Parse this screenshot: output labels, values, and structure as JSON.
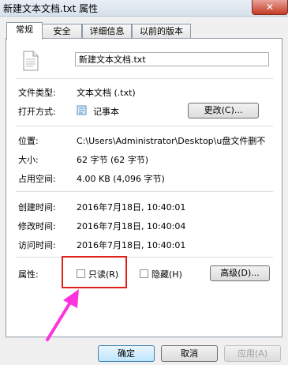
{
  "window": {
    "title": "新建文本文档.txt 属性",
    "close_glyph": "✕"
  },
  "tabs": [
    {
      "label": "常规",
      "active": true
    },
    {
      "label": "安全",
      "active": false
    },
    {
      "label": "详细信息",
      "active": false
    },
    {
      "label": "以前的版本",
      "active": false
    }
  ],
  "file": {
    "name": "新建文本文档.txt",
    "icon": "text-file-icon"
  },
  "info": {
    "type_label": "文件类型:",
    "type_value": "文本文档 (.txt)",
    "opens_label": "打开方式:",
    "opens_value": "记事本",
    "opens_icon": "notepad-icon",
    "change_button": "更改(C)...",
    "location_label": "位置:",
    "location_value": "C:\\Users\\Administrator\\Desktop\\u盘文件删不",
    "size_label": "大小:",
    "size_value": "62 字节 (62 字节)",
    "disk_label": "占用空间:",
    "disk_value": "4.00 KB (4,096 字节)",
    "created_label": "创建时间:",
    "created_value": "2016年7月18日, 10:40:01",
    "modified_label": "修改时间:",
    "modified_value": "2016年7月18日, 10:40:04",
    "accessed_label": "访问时间:",
    "accessed_value": "2016年7月18日, 10:40:01"
  },
  "attributes": {
    "label": "属性:",
    "readonly": {
      "label": "只读(R)",
      "checked": false
    },
    "hidden": {
      "label": "隐藏(H)",
      "checked": false
    },
    "advanced_button": "高级(D)..."
  },
  "footer": {
    "ok": "确定",
    "cancel": "取消",
    "apply": "应用(A)"
  },
  "colors": {
    "highlight": "#e0201a",
    "arrow": "#ff33dd"
  }
}
